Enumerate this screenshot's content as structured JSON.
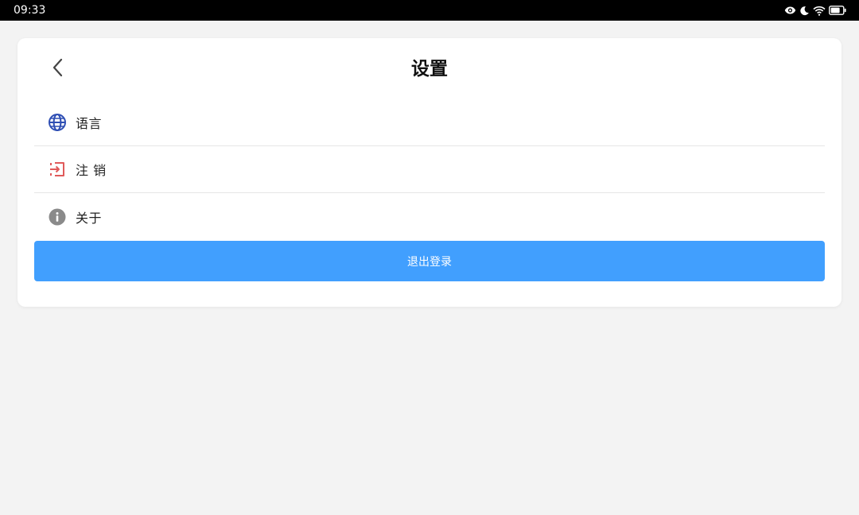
{
  "status_bar": {
    "time": "09:33"
  },
  "header": {
    "title": "设置"
  },
  "menu": {
    "items": [
      {
        "label": "语言",
        "icon": "globe-icon",
        "icon_color": "#2f4fb4"
      },
      {
        "label": "注 销",
        "icon": "sign-in-icon",
        "icon_color": "#e05a5a"
      },
      {
        "label": "关于",
        "icon": "info-icon",
        "icon_color": "#8a8a8a"
      }
    ]
  },
  "logout_button": {
    "label": "退出登录",
    "color": "#419ffe"
  }
}
